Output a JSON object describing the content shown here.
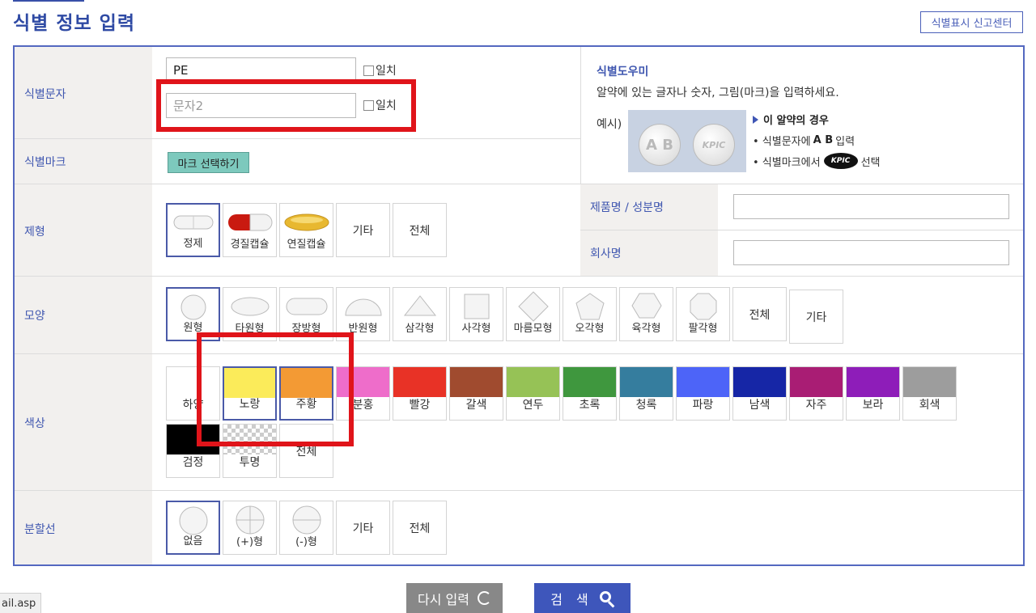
{
  "page": {
    "title": "식별 정보 입력",
    "report_button": "식별표시 신고센터"
  },
  "labels": {
    "char": "식별문자",
    "mark": "식별마크",
    "form": "제형",
    "shape": "모양",
    "color": "색상",
    "line": "분할선",
    "product": "제품명 / 성분명",
    "company": "회사명"
  },
  "char_inputs": {
    "char1_value": "PE",
    "char2_placeholder": "문자2",
    "match_label": "일치"
  },
  "mark_button": "마크 선택하기",
  "helper": {
    "title": "식별도우미",
    "desc": "알약에 있는 글자나 숫자, 그림(마크)을 입력하세요.",
    "example_label": "예시)",
    "pill_text_1": "A B",
    "pill_text_2": "KPIC",
    "case_title": "이 알약의 경우",
    "line1_pre": "• 식별문자에",
    "line1_bold": "A B",
    "line1_post": "입력",
    "line2_pre": "• 식별마크에서",
    "line2_badge": "KPIC",
    "line2_post": "선택"
  },
  "form_options": [
    "정제",
    "경질캡슐",
    "연질캡슐",
    "기타",
    "전체"
  ],
  "shape_options": [
    "원형",
    "타원형",
    "장방형",
    "반원형",
    "삼각형",
    "사각형",
    "마름모형",
    "오각형",
    "육각형",
    "팔각형",
    "전체",
    "기타"
  ],
  "color_options": [
    {
      "label": "하양",
      "hex": "#ffffff"
    },
    {
      "label": "노랑",
      "hex": "#fbeb5a"
    },
    {
      "label": "주황",
      "hex": "#f39a34"
    },
    {
      "label": "분홍",
      "hex": "#ee6dca"
    },
    {
      "label": "빨강",
      "hex": "#e83226"
    },
    {
      "label": "갈색",
      "hex": "#a04b2f"
    },
    {
      "label": "연두",
      "hex": "#96c256"
    },
    {
      "label": "초록",
      "hex": "#3f973e"
    },
    {
      "label": "청록",
      "hex": "#357d9e"
    },
    {
      "label": "파랑",
      "hex": "#4d64f8"
    },
    {
      "label": "남색",
      "hex": "#1626a6"
    },
    {
      "label": "자주",
      "hex": "#a91d74"
    },
    {
      "label": "보라",
      "hex": "#8e1db9"
    },
    {
      "label": "회색",
      "hex": "#9d9d9d"
    },
    {
      "label": "검정",
      "hex": "#000000"
    },
    {
      "label": "투명",
      "hex": "transparent"
    },
    {
      "label": "전체",
      "hex": ""
    }
  ],
  "line_options": [
    "없음",
    "(+)형",
    "(-)형",
    "기타",
    "전체"
  ],
  "buttons": {
    "reset": "다시 입력",
    "search": "검 색"
  },
  "status_bar": "ail.asp",
  "colors": {
    "accent": "#3e56bb",
    "label_bg": "#f2f0ee",
    "highlight": "#e0141a",
    "mark_button": "#7dc9bd"
  }
}
